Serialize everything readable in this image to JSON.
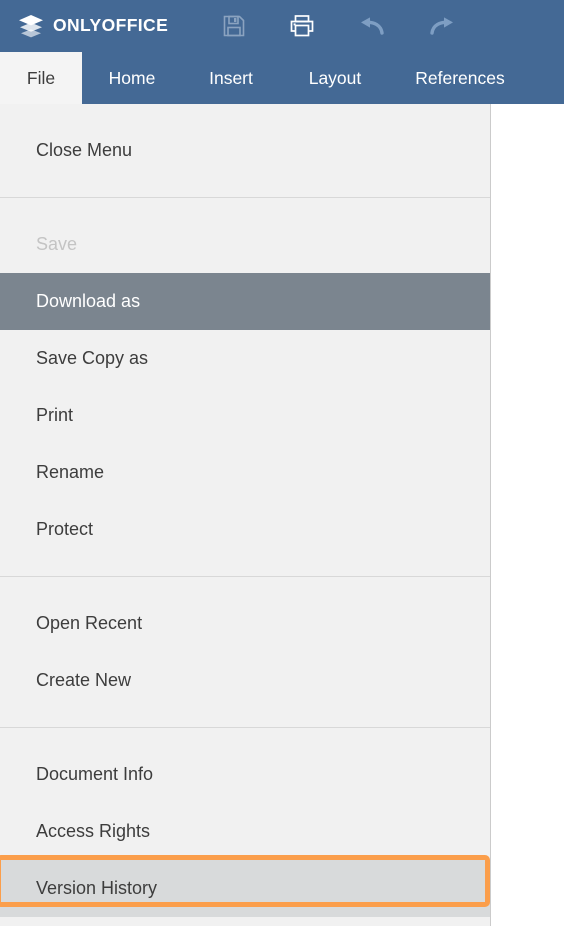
{
  "app": {
    "brand_name": "ONLYOFFICE",
    "logo_icon": "layers-stack-icon",
    "header_bg": "#446995",
    "accent_highlight": "#fb9e4b",
    "selected_bg": "#7b858f",
    "panel_bg": "#f1f1f1"
  },
  "header": {
    "tools": [
      {
        "name": "save-icon",
        "label": "Save",
        "disabled": true
      },
      {
        "name": "print-icon",
        "label": "Print",
        "disabled": false
      },
      {
        "name": "undo-icon",
        "label": "Undo",
        "disabled": false
      },
      {
        "name": "redo-icon",
        "label": "Redo",
        "disabled": false
      }
    ]
  },
  "tabs": [
    {
      "label": "File",
      "active": true
    },
    {
      "label": "Home",
      "active": false
    },
    {
      "label": "Insert",
      "active": false
    },
    {
      "label": "Layout",
      "active": false
    },
    {
      "label": "References",
      "active": false
    }
  ],
  "file_menu": {
    "groups": [
      {
        "items": [
          {
            "label": "Close Menu",
            "state": "normal"
          }
        ]
      },
      {
        "items": [
          {
            "label": "Save",
            "state": "disabled"
          },
          {
            "label": "Download as",
            "state": "selected"
          },
          {
            "label": "Save Copy as",
            "state": "normal"
          },
          {
            "label": "Print",
            "state": "normal"
          },
          {
            "label": "Rename",
            "state": "normal"
          },
          {
            "label": "Protect",
            "state": "normal"
          }
        ]
      },
      {
        "items": [
          {
            "label": "Open Recent",
            "state": "normal"
          },
          {
            "label": "Create New",
            "state": "normal"
          }
        ]
      },
      {
        "items": [
          {
            "label": "Document Info",
            "state": "normal"
          },
          {
            "label": "Access Rights",
            "state": "normal"
          },
          {
            "label": "Version History",
            "state": "highlight"
          }
        ]
      }
    ]
  }
}
